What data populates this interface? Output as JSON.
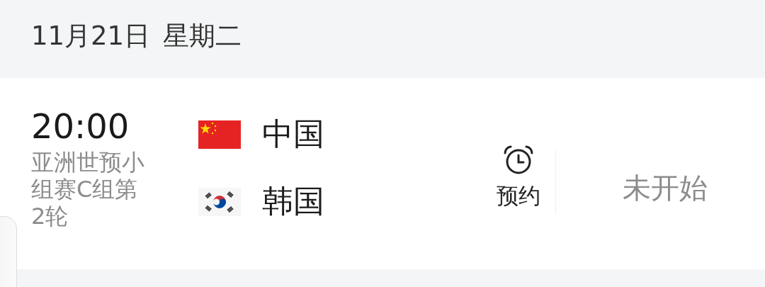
{
  "date_header": {
    "date": "11月21日",
    "weekday": "星期二"
  },
  "match": {
    "time": "20:00",
    "competition": "亚洲世预小组赛C组第2轮",
    "teams": [
      {
        "name": "中国"
      },
      {
        "name": "韩国"
      }
    ],
    "reminder": {
      "label": "预约"
    },
    "status": "未开始"
  }
}
